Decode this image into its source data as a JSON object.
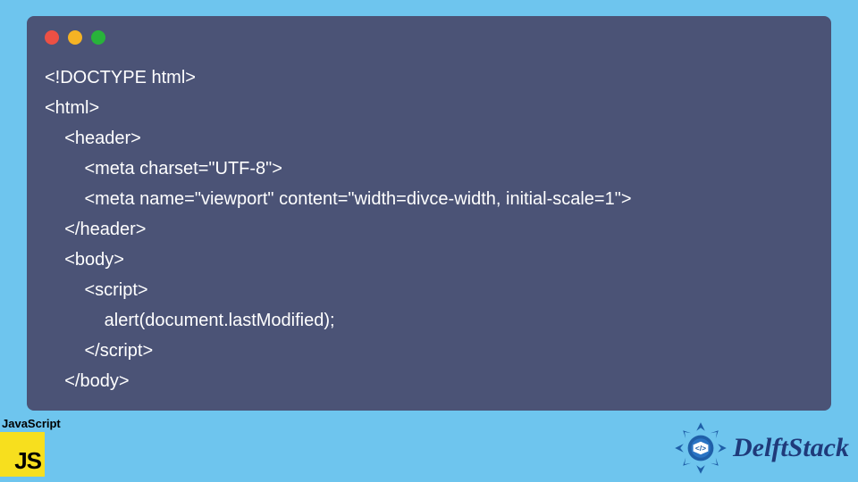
{
  "window": {
    "traffic_colors": {
      "red": "#ec5044",
      "yellow": "#f5b324",
      "green": "#28b33a"
    }
  },
  "code": {
    "lines": [
      "<!DOCTYPE html>",
      "<html>",
      "    <header>",
      "        <meta charset=\"UTF-8\">",
      "        <meta name=\"viewport\" content=\"width=divce-width, initial-scale=1\">",
      "    </header>",
      "    <body>",
      "        <script>",
      "            alert(document.lastModified);",
      "        </script>",
      "    </body>"
    ]
  },
  "footer": {
    "js_label": "JavaScript",
    "js_logo_text": "JS",
    "brand": "DelftStack"
  }
}
